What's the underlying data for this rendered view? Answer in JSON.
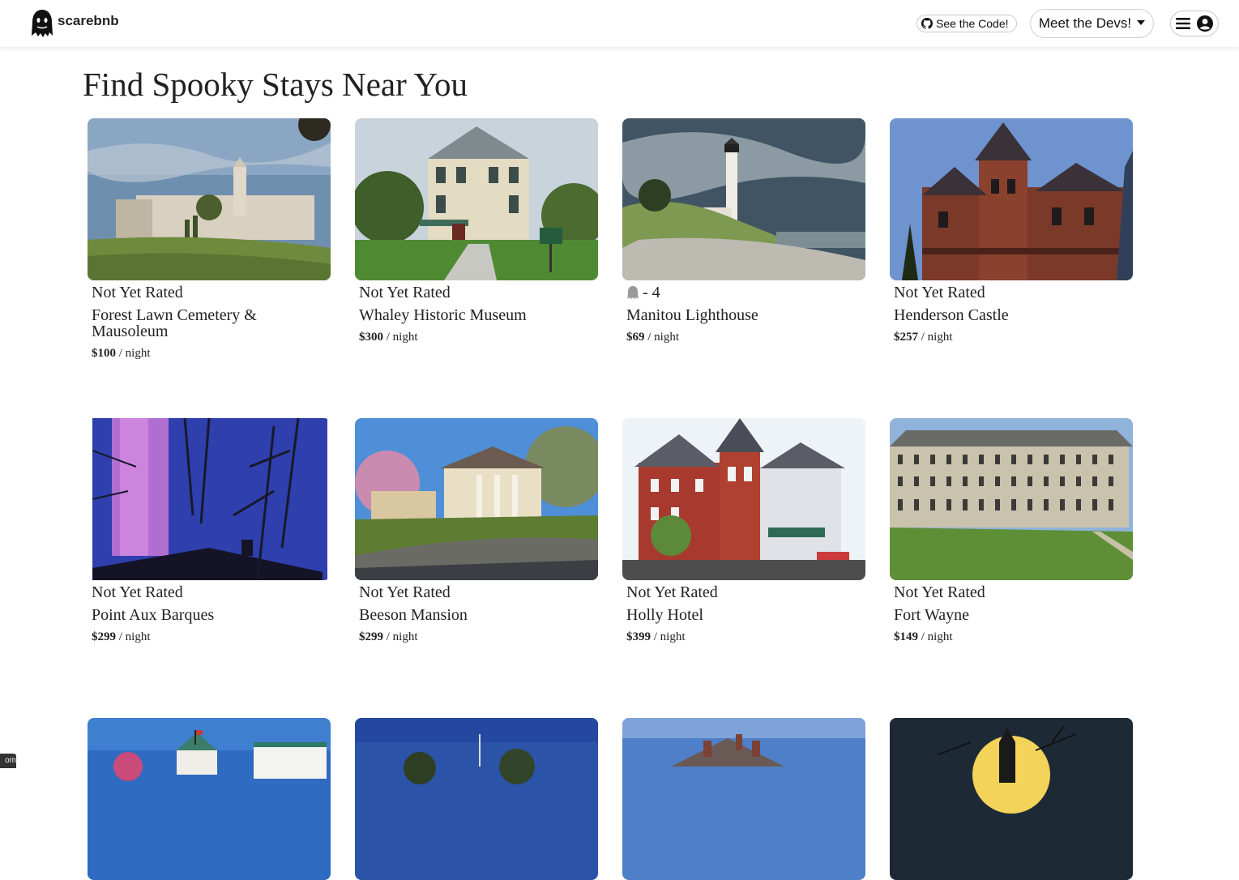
{
  "nav": {
    "brand": "scarebnb",
    "code_button": "See the Code!",
    "devs_button": "Meet the Devs!"
  },
  "main": {
    "title": "Find Spooky Stays Near You",
    "price_suffix": "/ night",
    "listings": [
      {
        "rating": "Not Yet Rated",
        "name": "Forest Lawn Cemetery & Mausoleum",
        "price": "$100"
      },
      {
        "rating": "Not Yet Rated",
        "name": "Whaley Historic Museum",
        "price": "$300"
      },
      {
        "rating": "- 4",
        "name": "Manitou Lighthouse",
        "price": "$69"
      },
      {
        "rating": "Not Yet Rated",
        "name": "Henderson Castle",
        "price": "$257"
      },
      {
        "rating": "Not Yet Rated",
        "name": "Point Aux Barques",
        "price": "$299"
      },
      {
        "rating": "Not Yet Rated",
        "name": "Beeson Mansion",
        "price": "$299"
      },
      {
        "rating": "Not Yet Rated",
        "name": "Holly Hotel",
        "price": "$399"
      },
      {
        "rating": "Not Yet Rated",
        "name": "Fort Wayne",
        "price": "$149"
      }
    ]
  },
  "corner_tag": "om"
}
